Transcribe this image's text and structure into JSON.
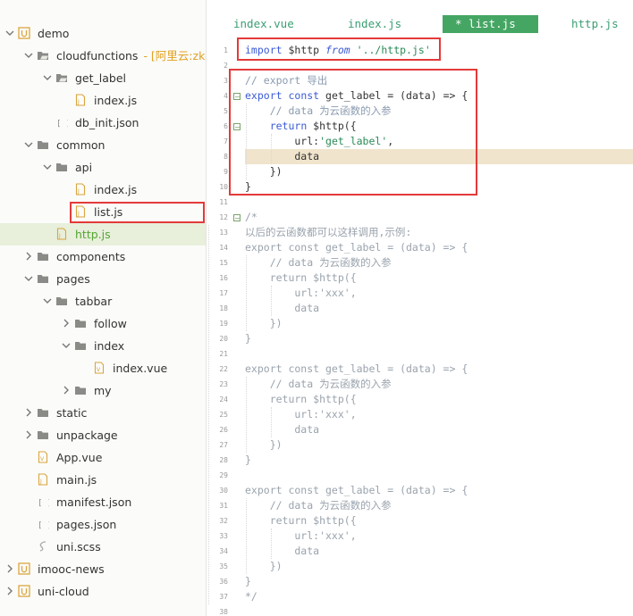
{
  "sidebar": {
    "items": [
      {
        "label": "demo",
        "depth": 0,
        "type": "project",
        "expanded": true
      },
      {
        "label": "cloudfunctions",
        "depth": 1,
        "type": "folder-cloud",
        "expanded": true,
        "extra": "- [阿里云:zk-d"
      },
      {
        "label": "get_label",
        "depth": 2,
        "type": "folder-cloud",
        "expanded": true
      },
      {
        "label": "index.js",
        "depth": 3,
        "type": "file-js"
      },
      {
        "label": "db_init.json",
        "depth": 2,
        "type": "file-json"
      },
      {
        "label": "common",
        "depth": 1,
        "type": "folder",
        "expanded": true
      },
      {
        "label": "api",
        "depth": 2,
        "type": "folder",
        "expanded": true
      },
      {
        "label": "index.js",
        "depth": 3,
        "type": "file-js"
      },
      {
        "label": "list.js",
        "depth": 3,
        "type": "file-js"
      },
      {
        "label": "http.js",
        "depth": 2,
        "type": "file-js",
        "selected": true
      },
      {
        "label": "components",
        "depth": 1,
        "type": "folder",
        "expanded": false
      },
      {
        "label": "pages",
        "depth": 1,
        "type": "folder",
        "expanded": true
      },
      {
        "label": "tabbar",
        "depth": 2,
        "type": "folder",
        "expanded": true
      },
      {
        "label": "follow",
        "depth": 3,
        "type": "folder",
        "expanded": false
      },
      {
        "label": "index",
        "depth": 3,
        "type": "folder",
        "expanded": true
      },
      {
        "label": "index.vue",
        "depth": 4,
        "type": "file-vue"
      },
      {
        "label": "my",
        "depth": 3,
        "type": "folder",
        "expanded": false
      },
      {
        "label": "static",
        "depth": 1,
        "type": "folder",
        "expanded": false
      },
      {
        "label": "unpackage",
        "depth": 1,
        "type": "folder",
        "expanded": false
      },
      {
        "label": "App.vue",
        "depth": 1,
        "type": "file-vue"
      },
      {
        "label": "main.js",
        "depth": 1,
        "type": "file-js"
      },
      {
        "label": "manifest.json",
        "depth": 1,
        "type": "file-json"
      },
      {
        "label": "pages.json",
        "depth": 1,
        "type": "file-json"
      },
      {
        "label": "uni.scss",
        "depth": 1,
        "type": "file-scss"
      },
      {
        "label": "imooc-news",
        "depth": 0,
        "type": "project",
        "expanded": false
      },
      {
        "label": "uni-cloud",
        "depth": 0,
        "type": "project",
        "expanded": false
      }
    ]
  },
  "tabs": [
    {
      "label": "index.vue",
      "active": false
    },
    {
      "label": "index.js",
      "active": false
    },
    {
      "label": "* list.js",
      "active": true
    },
    {
      "label": "http.js",
      "active": false
    }
  ],
  "editor": {
    "lines": [
      {
        "n": "1",
        "text": "import $http from '../http.js'"
      },
      {
        "n": "2",
        "text": ""
      },
      {
        "n": "3",
        "text": "// export 导出"
      },
      {
        "n": "4",
        "text": "export const get_label = (data) => {",
        "fold": "minus"
      },
      {
        "n": "5",
        "text": "    // data 为云函数的入参"
      },
      {
        "n": "6",
        "text": "    return $http({",
        "fold": "minus"
      },
      {
        "n": "7",
        "text": "        url:'get_label',"
      },
      {
        "n": "8",
        "text": "        data",
        "current": true
      },
      {
        "n": "9",
        "text": "    })"
      },
      {
        "n": "10",
        "text": "}"
      },
      {
        "n": "11",
        "text": ""
      },
      {
        "n": "12",
        "text": "/*",
        "fold": "minus"
      },
      {
        "n": "13",
        "text": "以后的云函数都可以这样调用,示例:"
      },
      {
        "n": "14",
        "text": "export const get_label = (data) => {"
      },
      {
        "n": "15",
        "text": "    // data 为云函数的入参"
      },
      {
        "n": "16",
        "text": "    return $http({"
      },
      {
        "n": "17",
        "text": "        url:'xxx',"
      },
      {
        "n": "18",
        "text": "        data"
      },
      {
        "n": "19",
        "text": "    })"
      },
      {
        "n": "20",
        "text": "}"
      },
      {
        "n": "21",
        "text": ""
      },
      {
        "n": "22",
        "text": "export const get_label = (data) => {"
      },
      {
        "n": "23",
        "text": "    // data 为云函数的入参"
      },
      {
        "n": "24",
        "text": "    return $http({"
      },
      {
        "n": "25",
        "text": "        url:'xxx',"
      },
      {
        "n": "26",
        "text": "        data"
      },
      {
        "n": "27",
        "text": "    })"
      },
      {
        "n": "28",
        "text": "}"
      },
      {
        "n": "29",
        "text": ""
      },
      {
        "n": "30",
        "text": "export const get_label = (data) => {"
      },
      {
        "n": "31",
        "text": "    // data 为云函数的入参"
      },
      {
        "n": "32",
        "text": "    return $http({"
      },
      {
        "n": "33",
        "text": "        url:'xxx',"
      },
      {
        "n": "34",
        "text": "        data"
      },
      {
        "n": "35",
        "text": "    })"
      },
      {
        "n": "36",
        "text": "}"
      },
      {
        "n": "37",
        "text": "*/"
      },
      {
        "n": "38",
        "text": ""
      }
    ]
  },
  "colors": {
    "highlight_box": "#e33a3a",
    "active_tab": "#45a664",
    "selected_text": "#55a532"
  }
}
